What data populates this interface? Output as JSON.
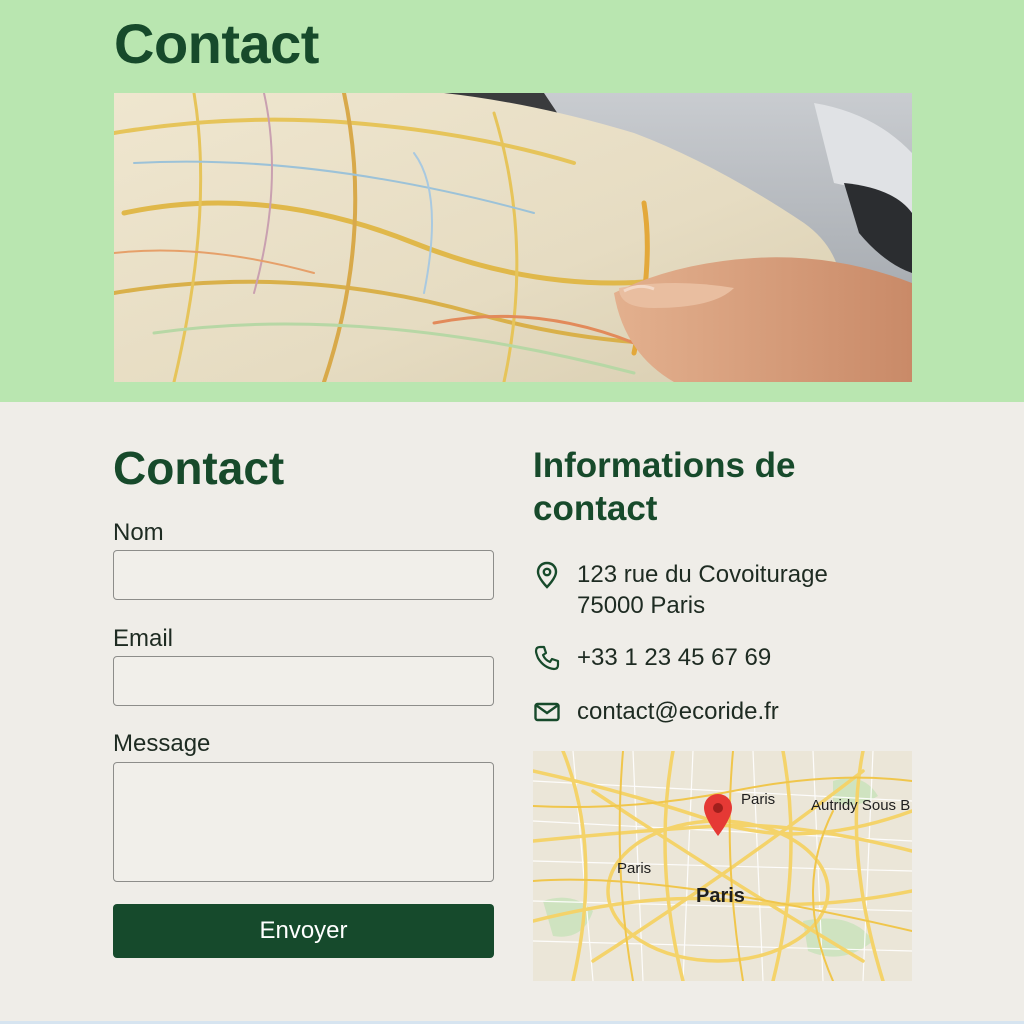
{
  "hero": {
    "title": "Contact",
    "image_description": ""
  },
  "form": {
    "title": "Contact",
    "name_label": "Nom",
    "name_value": "",
    "email_label": "Email",
    "email_value": "",
    "message_label": "Message",
    "message_value": "",
    "submit_label": "Envoyer"
  },
  "info": {
    "title": "Informations de contact",
    "address_line1": "123 rue du Covoiturage",
    "address_line2": "75000 Paris",
    "phone": "+33 1 23 45 67 69",
    "email": "contact@ecoride.fr"
  },
  "map": {
    "labels": {
      "top": "Paris",
      "top_right": "Autridy Sous B",
      "left": "Paris",
      "center": "Paris"
    }
  },
  "colors": {
    "hero_bg": "#b9e6b0",
    "brand_dark_green": "#164a2c",
    "page_bg": "#efede8",
    "map_pin": "#e53935"
  },
  "icons": {
    "address": "location-pin-icon",
    "phone": "phone-icon",
    "email": "mail-icon",
    "map_marker": "map-marker-icon"
  }
}
